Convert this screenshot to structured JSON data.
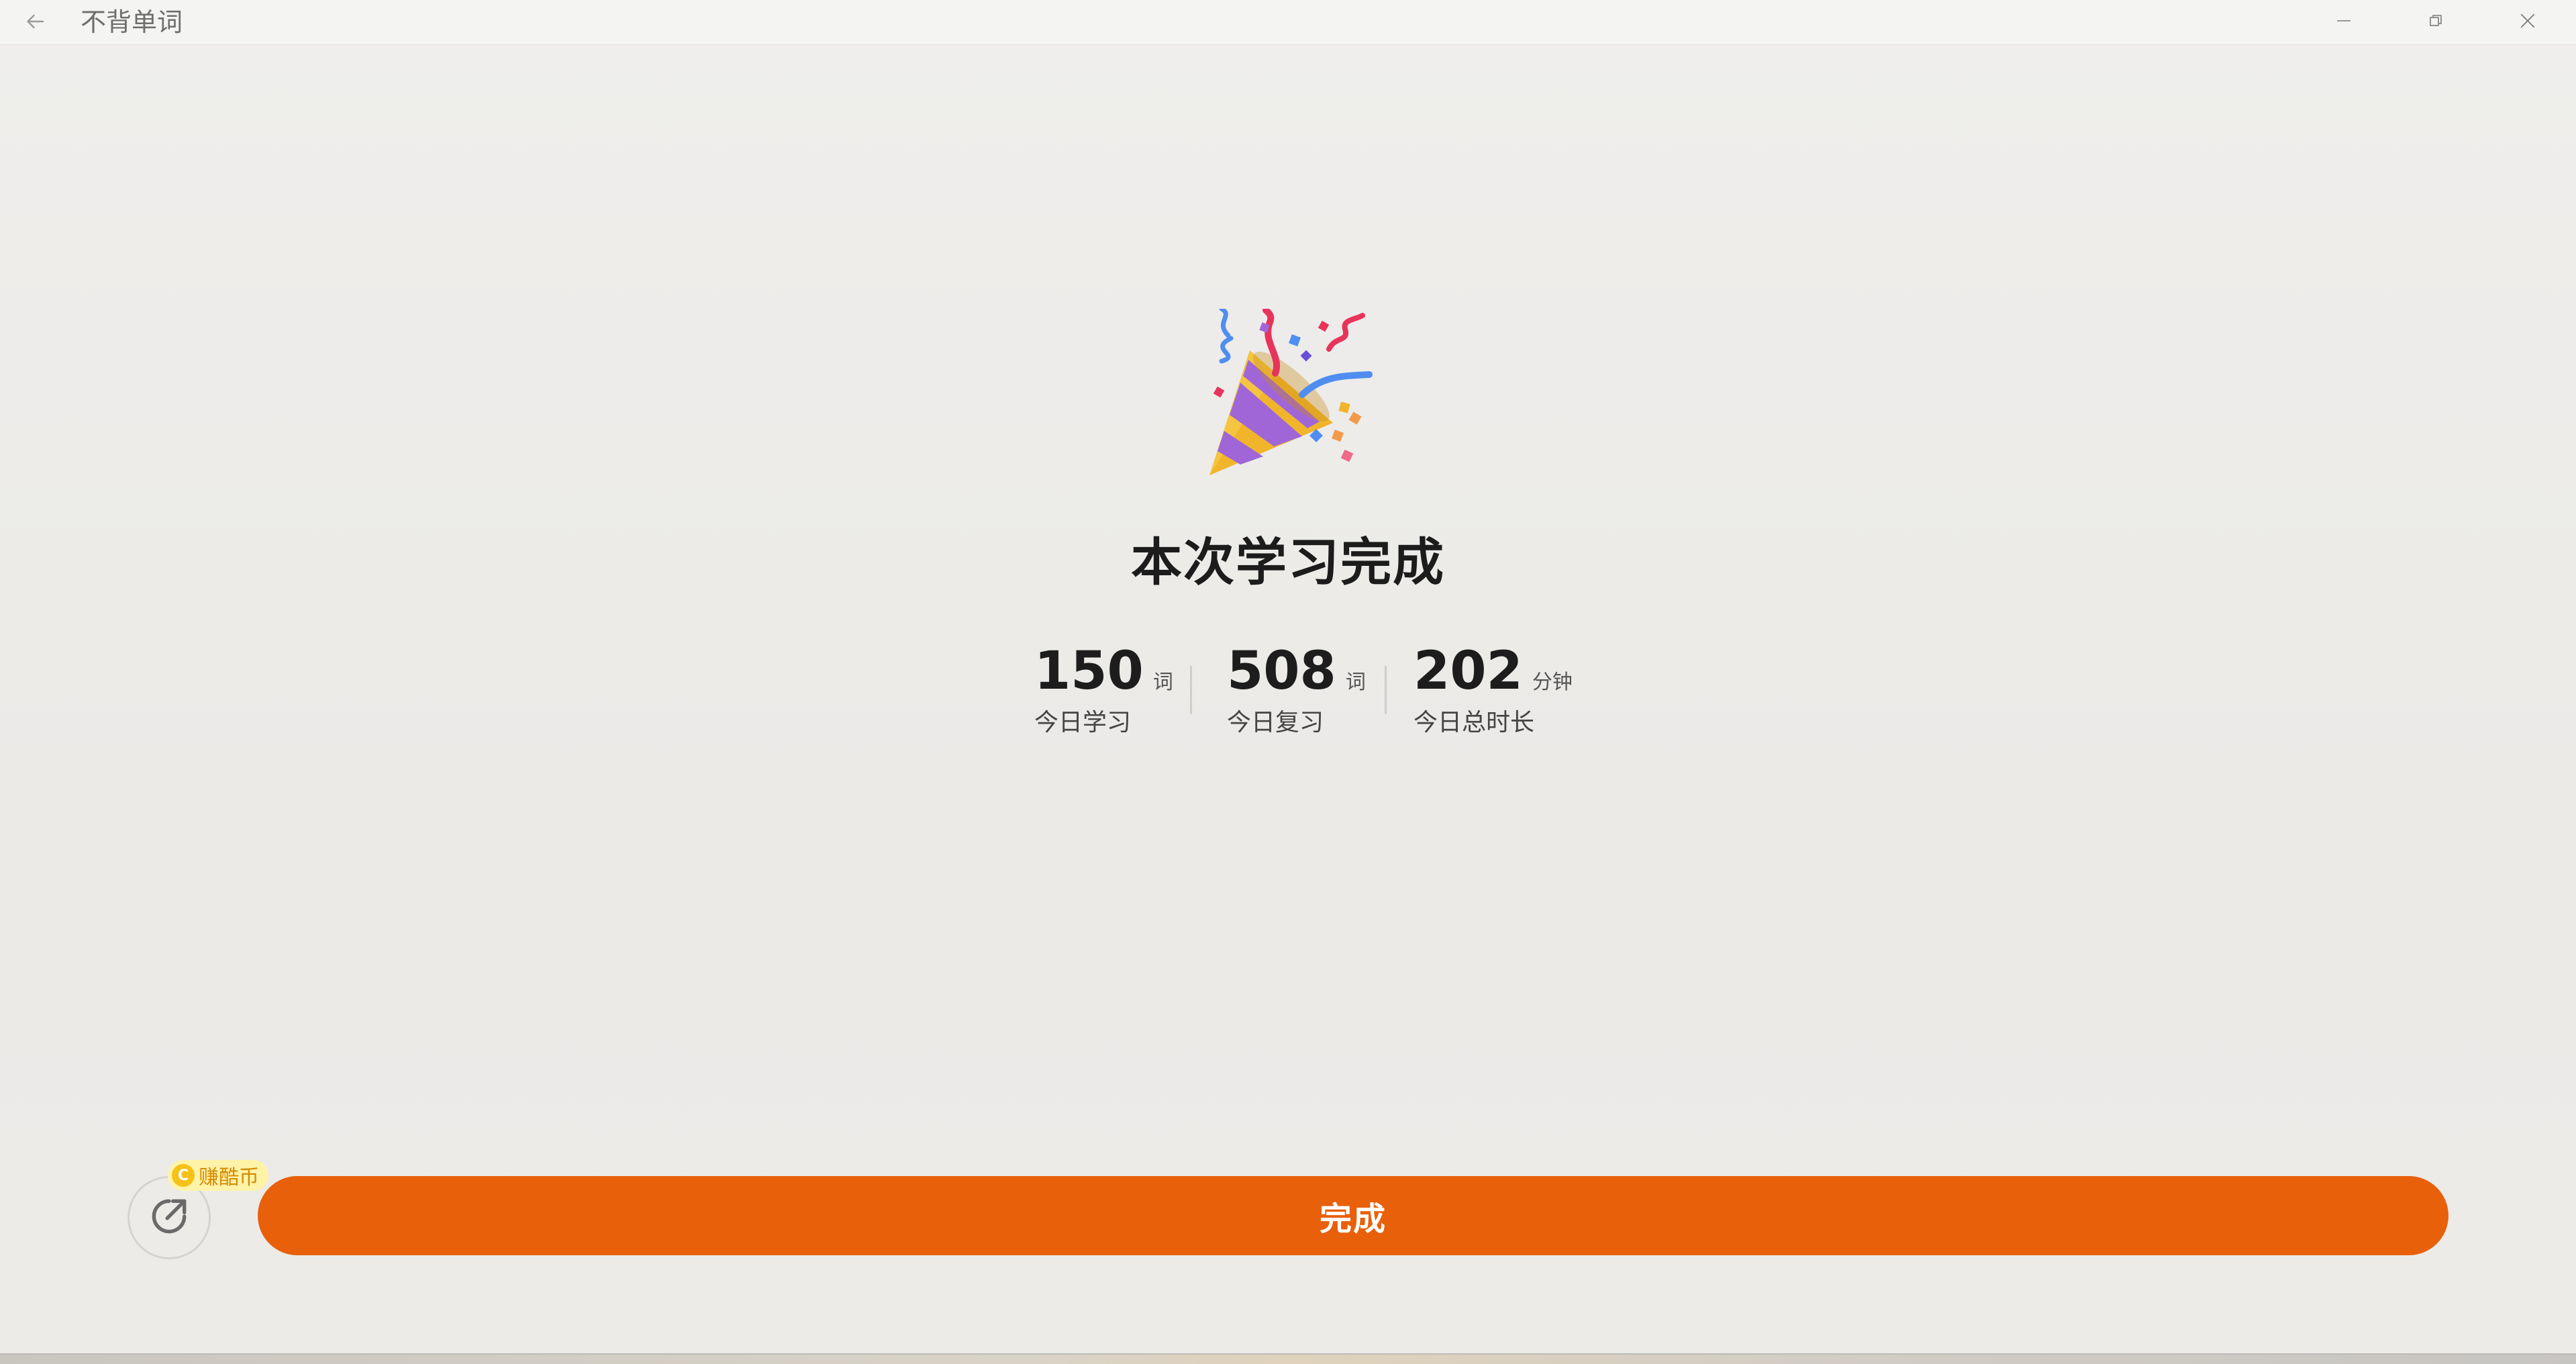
{
  "window": {
    "title": "不背单词",
    "controls": [
      "minimize-icon",
      "restore-icon",
      "close-icon"
    ]
  },
  "hero": {
    "icon": "party-popper-icon"
  },
  "headline": "本次学习完成",
  "stats": [
    {
      "value": "150",
      "unit": "词",
      "label": "今日学习"
    },
    {
      "value": "508",
      "unit": "词",
      "label": "今日复习"
    },
    {
      "value": "202",
      "unit": "分钟",
      "label": "今日总时长"
    }
  ],
  "footer": {
    "share_icon": "share-icon",
    "coin_badge": {
      "icon_letter": "C",
      "label": "赚酷币"
    },
    "done_label": "完成"
  },
  "colors": {
    "accent": "#e8600a",
    "background": "#ecebe8",
    "badge_bg": "#fff3a8",
    "badge_text": "#d48a00"
  }
}
